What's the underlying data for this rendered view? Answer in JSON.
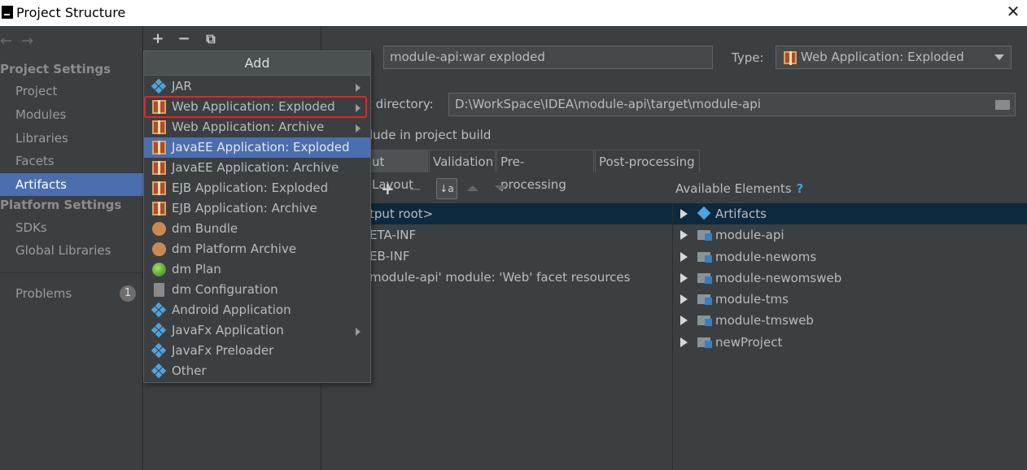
{
  "window": {
    "title": "Project Structure",
    "close_glyph": "✕"
  },
  "nav": {
    "back": "←",
    "forward": "→"
  },
  "sidebar": {
    "project_settings": "Project Settings",
    "items": [
      {
        "label": "Project"
      },
      {
        "label": "Modules"
      },
      {
        "label": "Libraries"
      },
      {
        "label": "Facets"
      },
      {
        "label": "Artifacts",
        "selected": true
      }
    ],
    "platform_settings": "Platform Settings",
    "platform_items": [
      {
        "label": "SDKs"
      },
      {
        "label": "Global Libraries"
      }
    ],
    "problems": {
      "label": "Problems",
      "count": "1"
    }
  },
  "toolbar": {
    "add": "+",
    "remove": "−",
    "copy": "⧉"
  },
  "popup": {
    "title": "Add",
    "items": [
      {
        "label": "JAR",
        "icon": "diamond-icon",
        "submenu": true
      },
      {
        "label": "Web Application: Exploded",
        "icon": "gift-icon",
        "submenu": true,
        "highlighted": true
      },
      {
        "label": "Web Application: Archive",
        "icon": "gift-icon",
        "submenu": true
      },
      {
        "label": "JavaEE Application: Exploded",
        "icon": "gift-icon",
        "hover": true
      },
      {
        "label": "JavaEE Application: Archive",
        "icon": "gift-icon"
      },
      {
        "label": "EJB Application: Exploded",
        "icon": "gift-icon"
      },
      {
        "label": "EJB Application: Archive",
        "icon": "gift-icon"
      },
      {
        "label": "dm Bundle",
        "icon": "bundle-icon"
      },
      {
        "label": "dm Platform Archive",
        "icon": "bundle-icon"
      },
      {
        "label": "dm Plan",
        "icon": "globe-icon"
      },
      {
        "label": "dm Configuration",
        "icon": "document-icon"
      },
      {
        "label": "Android Application",
        "icon": "diamond-icon"
      },
      {
        "label": "JavaFx Application",
        "icon": "diamond-icon",
        "submenu": true
      },
      {
        "label": "JavaFx Preloader",
        "icon": "diamond-icon"
      },
      {
        "label": "Other",
        "icon": "diamond-icon"
      }
    ]
  },
  "artifact": {
    "name_value": "module-api:war exploded",
    "type_label": "Type:",
    "type_value": "Web Application: Exploded",
    "output_dir_label": "t directory:",
    "output_dir_value": "D:\\WorkSpace\\IDEA\\module-api\\target\\module-api",
    "include_build": "lude in project build",
    "tabs": [
      "ut Layout",
      "Validation",
      "Pre-processing",
      "Post-processing"
    ],
    "layout_tree": [
      "tput root>",
      "ETA-INF",
      "EB-INF",
      "module-api' module: 'Web' facet resources"
    ],
    "available_title": "Available Elements",
    "available_help": "?",
    "available": [
      {
        "label": "Artifacts",
        "icon": "artifacts-icon"
      },
      {
        "label": "module-api",
        "icon": "module-icon"
      },
      {
        "label": "module-newoms",
        "icon": "module-icon"
      },
      {
        "label": "module-newomsweb",
        "icon": "module-icon"
      },
      {
        "label": "module-tms",
        "icon": "module-icon"
      },
      {
        "label": "module-tmsweb",
        "icon": "module-icon"
      },
      {
        "label": "newProject",
        "icon": "module-icon"
      }
    ]
  }
}
